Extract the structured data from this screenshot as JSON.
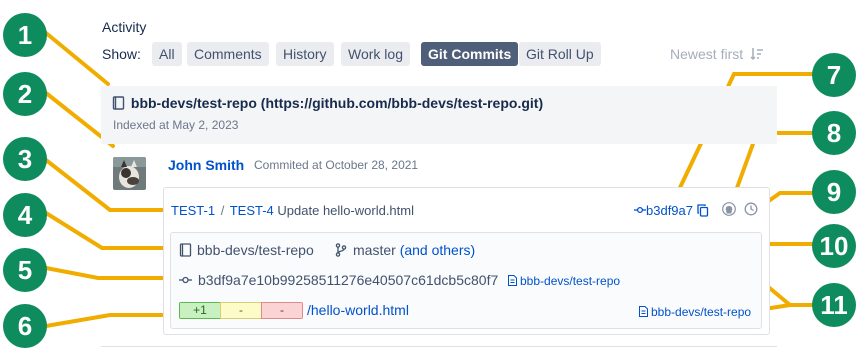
{
  "activity": {
    "title": "Activity",
    "show_label": "Show:",
    "tabs": [
      {
        "label": "All",
        "active": false
      },
      {
        "label": "Comments",
        "active": false
      },
      {
        "label": "History",
        "active": false
      },
      {
        "label": "Work log",
        "active": false
      },
      {
        "label": "Git Commits",
        "active": true
      },
      {
        "label": "Git Roll Up",
        "active": false
      }
    ],
    "sort_label": "Newest first",
    "sort_icon": "sort-descending-icon"
  },
  "repo": {
    "title": "bbb-devs/test-repo (https://github.com/bbb-devs/test-repo.git)",
    "indexed": "Indexed at May 2, 2023",
    "icon": "repository-icon"
  },
  "commit": {
    "author": "John Smith",
    "date_label": "Commited at October 28, 2021",
    "issue1": "TEST-1",
    "separator": "/",
    "issue2": "TEST-4",
    "message": "Update hello-world.html",
    "short_hash": "b3df9a7",
    "repo_name": "bbb-devs/test-repo",
    "branch": "master",
    "others": "(and others)",
    "full_hash": "b3df9a7e10b99258511276e40507c61dcb5c80f7",
    "hash_repo_link": "bbb-devs/test-repo",
    "file": {
      "added": "+1",
      "modified": "-",
      "deleted": "-",
      "path": "/hello-world.html",
      "repo_link": "bbb-devs/test-repo"
    }
  },
  "callouts": [
    "1",
    "2",
    "3",
    "4",
    "5",
    "6",
    "7",
    "8",
    "9",
    "10",
    "11"
  ],
  "colors": {
    "callout": "#0e8c5e",
    "leader_line": "#f0ad00",
    "link": "#0052cc",
    "active_tab": "#505f79"
  }
}
